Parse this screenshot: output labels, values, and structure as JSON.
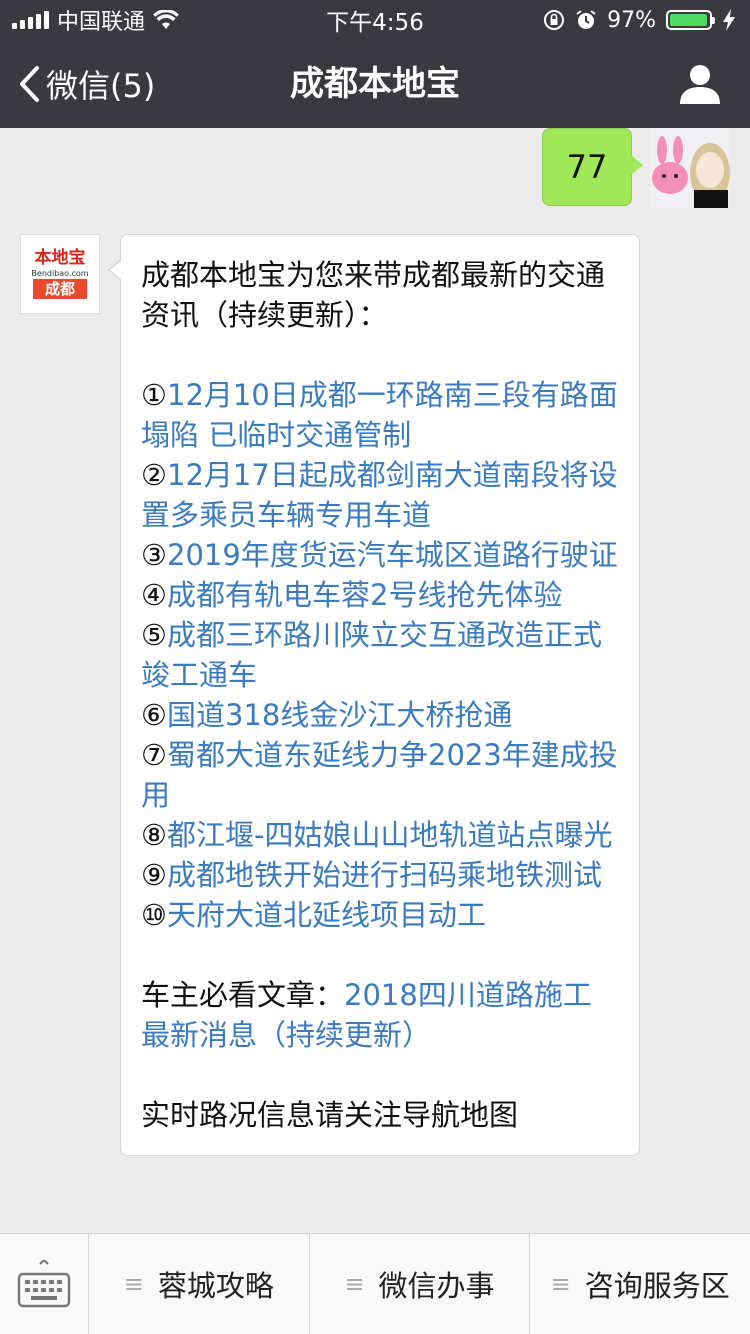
{
  "status_bar": {
    "carrier": "中国联通",
    "time": "下午4:56",
    "battery": "97%",
    "battery_level": 0.97
  },
  "nav": {
    "back_label": "微信(5)",
    "title": "成都本地宝"
  },
  "messages": {
    "outgoing": {
      "text": "77"
    },
    "incoming": {
      "avatar": {
        "name": "本地宝",
        "url": "Bendibao.com",
        "city": "成都"
      },
      "intro": "成都本地宝为您来带成都最新的交通资讯（持续更新）：",
      "news": [
        {
          "num": "①",
          "text": "12月10日成都一环路南三段有路面塌陷 已临时交通管制"
        },
        {
          "num": "②",
          "text": "12月17日起成都剑南大道南段将设置多乘员车辆专用车道"
        },
        {
          "num": "③",
          "text": "2019年度货运汽车城区道路行驶证"
        },
        {
          "num": "④",
          "text": "成都有轨电车蓉2号线抢先体验"
        },
        {
          "num": "⑤",
          "text": "成都三环路川陕立交互通改造正式竣工通车"
        },
        {
          "num": "⑥",
          "text": "国道318线金沙江大桥抢通"
        },
        {
          "num": "⑦",
          "text": "蜀都大道东延线力争2023年建成投用"
        },
        {
          "num": "⑧",
          "text": "都江堰-四姑娘山山地轨道站点曝光"
        },
        {
          "num": "⑨",
          "text": "成都地铁开始进行扫码乘地铁测试"
        },
        {
          "num": "⑩",
          "text": "天府大道北延线项目动工"
        }
      ],
      "article_prefix": "车主必看文章：",
      "article_link": "2018四川道路施工最新消息（持续更新）",
      "cut_text": "实时路况信息请关注导航地图"
    }
  },
  "bottom_menu": {
    "items": [
      "蓉城攻略",
      "微信办事",
      "咨询服务区"
    ]
  },
  "colors": {
    "nav_bg": "#39393f",
    "link": "#3b7bbf",
    "outgoing_bubble": "#a0e75a",
    "battery_fill": "#4cd964"
  }
}
